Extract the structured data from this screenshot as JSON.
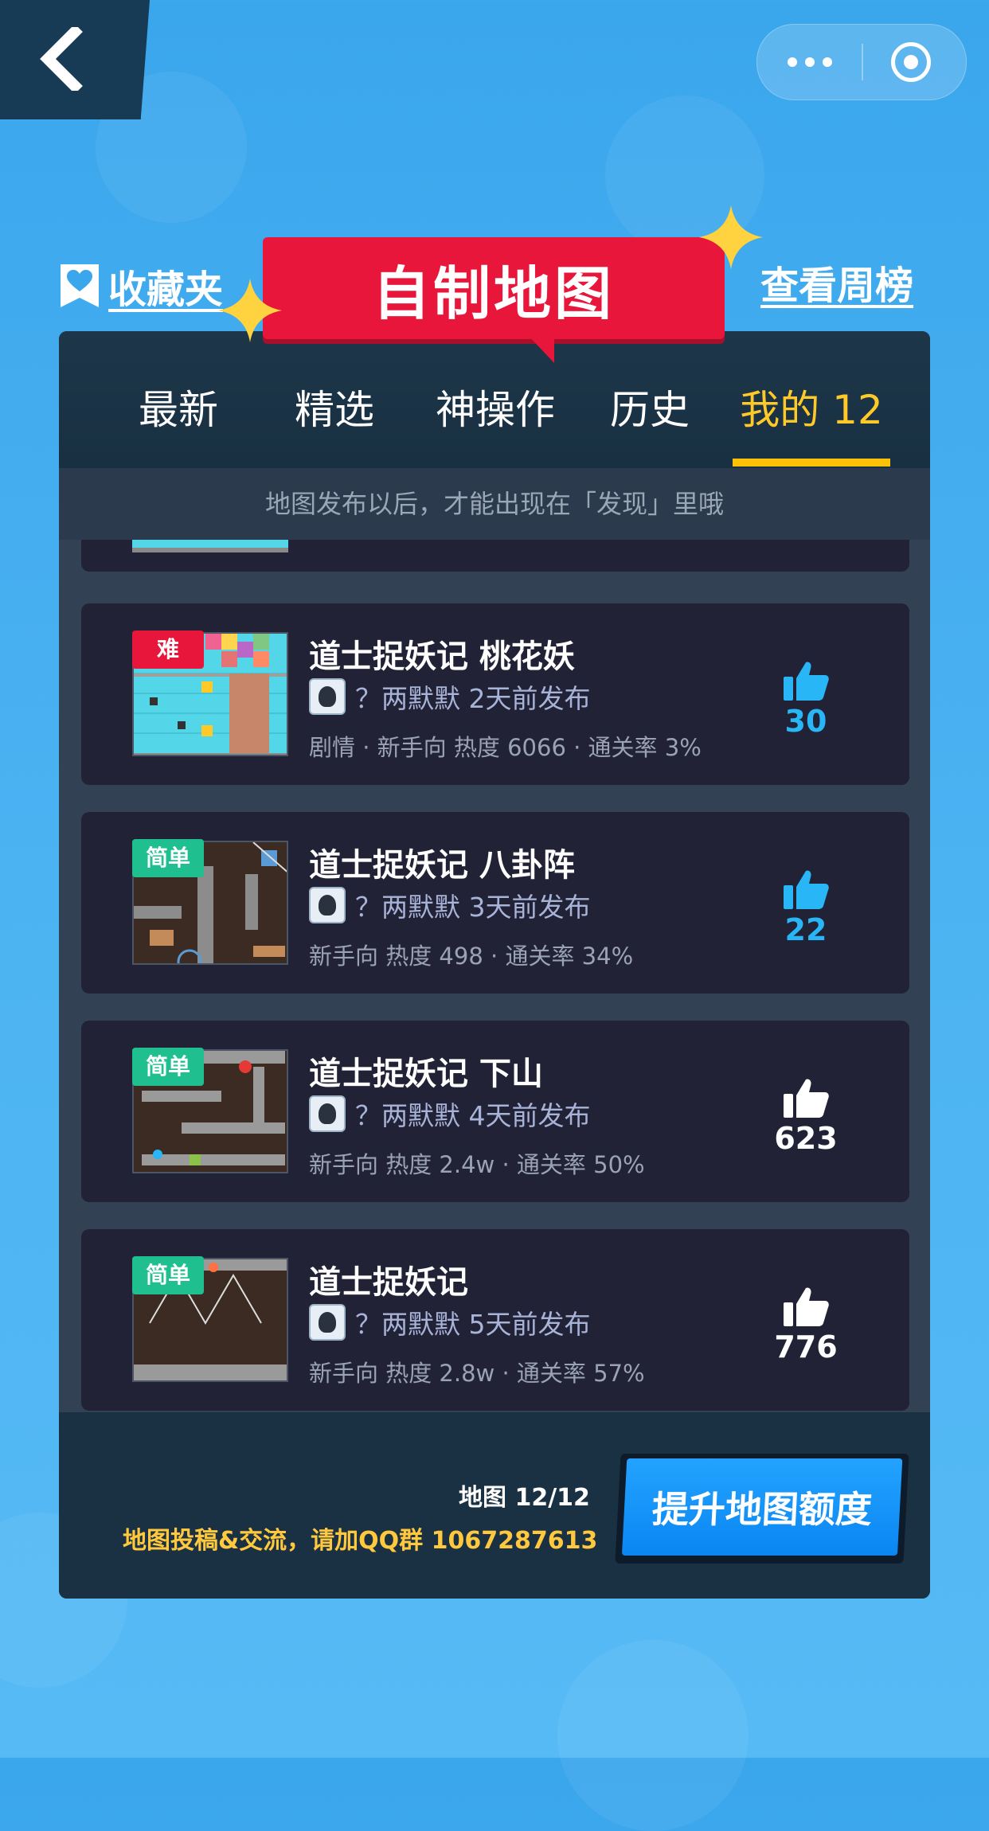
{
  "nav": {
    "back_icon": "chevron-left-icon",
    "more_icon": "more-dots-icon",
    "close_icon": "target-circle-icon"
  },
  "header": {
    "favorites_label": "收藏夹",
    "title": "自制地图",
    "weekly_rank_label": "查看周榜"
  },
  "tabs": [
    {
      "label": "最新",
      "active": false
    },
    {
      "label": "精选",
      "active": false
    },
    {
      "label": "神操作",
      "active": false
    },
    {
      "label": "历史",
      "active": false
    },
    {
      "label": "我的 12",
      "active": true
    }
  ],
  "notice": "地图发布以后，才能出现在「发现」里哦",
  "maps": [
    {
      "difficulty": "难",
      "title": "道士捉妖记 桃花妖",
      "author": "？两默默 2天前发布",
      "meta": "剧情 · 新手向 热度 6066 · 通关率 3%",
      "likes": "30",
      "liked": true
    },
    {
      "difficulty": "简单",
      "title": "道士捉妖记 八卦阵",
      "author": "？两默默 3天前发布",
      "meta": "新手向 热度 498 · 通关率 34%",
      "likes": "22",
      "liked": true
    },
    {
      "difficulty": "简单",
      "title": "道士捉妖记 下山",
      "author": "？两默默 4天前发布",
      "meta": "新手向 热度 2.4w · 通关率 50%",
      "likes": "623",
      "liked": false
    },
    {
      "difficulty": "简单",
      "title": "道士捉妖记",
      "author": "？两默默 5天前发布",
      "meta": "新手向 热度 2.8w · 通关率 57%",
      "likes": "776",
      "liked": false
    }
  ],
  "footer": {
    "map_count": "地图 12/12",
    "qq_text": "地图投稿&交流，请加QQ群 1067287613",
    "upgrade_label": "提升地图额度"
  },
  "colors": {
    "accent_red": "#e8163a",
    "accent_yellow": "#ffc107",
    "like_blue": "#29b6f6",
    "easy_green": "#1fbf8f"
  }
}
